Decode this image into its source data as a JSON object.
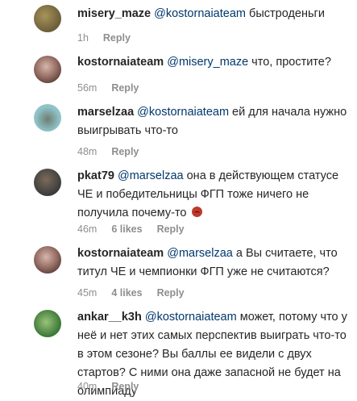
{
  "comments": [
    {
      "username": "misery_maze",
      "mention": "@kostornaiateam",
      "text": " быстроденьги",
      "time": "1h",
      "likes": "",
      "reply": "Reply",
      "avatar_colors": [
        "#6a5d3a",
        "#a8945a"
      ]
    },
    {
      "username": "kostornaiateam",
      "mention": "@misery_maze",
      "text": " что, простите?",
      "time": "56m",
      "likes": "",
      "reply": "Reply",
      "avatar_colors": [
        "#c9a59a",
        "#6a4d45"
      ]
    },
    {
      "username": "marselzaa",
      "mention": "@kostornaiateam",
      "text": " ей для начала нужно выигрывать что-то",
      "time": "48m",
      "likes": "",
      "reply": "Reply",
      "avatar_colors": [
        "#8fc3c9",
        "#5a6a5f"
      ]
    },
    {
      "username": "pkat79",
      "mention": "@marselzaa",
      "text": " она в действующем статусе ЧЕ и победительницы ФГП тоже ничего не получила почему-то",
      "time": "46m",
      "likes": "6 likes",
      "reply": "Reply",
      "avatar_colors": [
        "#3b3b3b",
        "#7a6b5a"
      ]
    },
    {
      "username": "kostornaiateam",
      "mention": "@marselzaa",
      "text": " а Вы считаете, что титул ЧЕ и чемпионки ФГП уже не считаются?",
      "time": "45m",
      "likes": "4 likes",
      "reply": "Reply",
      "avatar_colors": [
        "#c9a59a",
        "#6a4d45"
      ]
    },
    {
      "username": "ankar__k3h",
      "mention": "@kostornaiateam",
      "text": " может, потому что у неё и нет этих самых перспектив выиграть что-то в этом сезоне? Вы баллы ее видели с двух стартов? С ними она даже запасной не будет на олимпиаду",
      "time": "40m",
      "likes": "",
      "reply": "Reply",
      "avatar_colors": [
        "#3f7a3a",
        "#9ac47a"
      ]
    }
  ]
}
